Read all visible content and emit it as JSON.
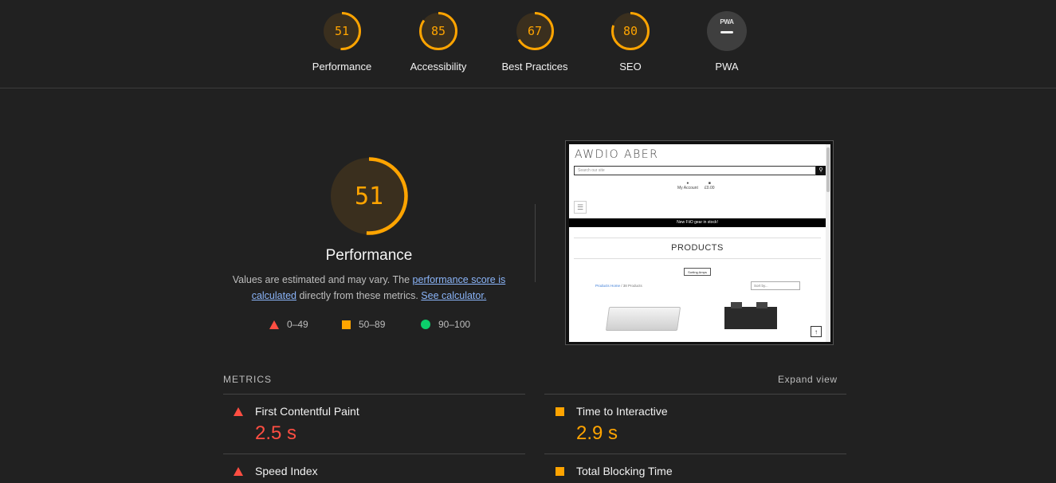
{
  "top_scores": [
    {
      "label": "Performance",
      "score": "51",
      "color": "#ffa400"
    },
    {
      "label": "Accessibility",
      "score": "85",
      "color": "#ffa400"
    },
    {
      "label": "Best Practices",
      "score": "67",
      "color": "#ffa400"
    },
    {
      "label": "SEO",
      "score": "80",
      "color": "#ffa400"
    },
    {
      "label": "PWA",
      "badge_text": "PWA",
      "color": "#3f3f3f"
    }
  ],
  "main": {
    "score": "51",
    "title": "Performance",
    "desc_part1": "Values are estimated and may vary. The ",
    "desc_link1": "performance score is calculated",
    "desc_part2": " directly from these metrics. ",
    "desc_link2": "See calculator.",
    "legend": [
      {
        "icon": "triangle-red",
        "range": "0–49"
      },
      {
        "icon": "square-orange",
        "range": "50–89"
      },
      {
        "icon": "circle-green",
        "range": "90–100"
      }
    ]
  },
  "screenshot": {
    "logo": "AWDIO ABER",
    "search_placeholder": "Search our site",
    "account_label": "My Account",
    "cart_label": "£0.00",
    "banner": "New FiiO gear in stock!",
    "heading": "PRODUCTS",
    "sort_button": "Sorting Amps",
    "breadcrumb_link": "Products Home",
    "breadcrumb_rest": " / 38 Products",
    "sort_select": "Sort by..."
  },
  "metrics": {
    "header": "METRICS",
    "expand_label": "Expand view",
    "items": [
      {
        "title": "First Contentful Paint",
        "value": "2.5 s",
        "status": "red"
      },
      {
        "title": "Time to Interactive",
        "value": "2.9 s",
        "status": "orange"
      },
      {
        "title": "Speed Index",
        "value": "",
        "status": "red"
      },
      {
        "title": "Total Blocking Time",
        "value": "",
        "status": "orange"
      }
    ]
  },
  "colors": {
    "background": "#212121",
    "orange": "#ffa400",
    "red": "#ff4e42",
    "green": "#0cce6b",
    "link": "#8ab4f8"
  }
}
